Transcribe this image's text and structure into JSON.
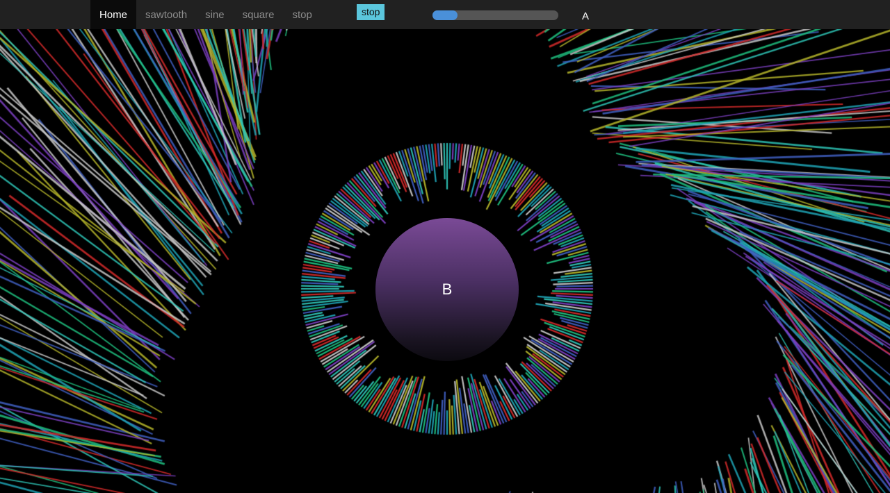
{
  "nav": {
    "items": [
      {
        "label": "Home",
        "active": true
      },
      {
        "label": "sawtooth",
        "active": false
      },
      {
        "label": "sine",
        "active": false
      },
      {
        "label": "square",
        "active": false
      },
      {
        "label": "stop",
        "active": false
      }
    ]
  },
  "controls": {
    "stop_label": "stop",
    "accent_color": "#5bc6dc",
    "slider_fraction": 0.2,
    "slider_color": "#4a90d9",
    "marker_label": "A"
  },
  "visualizer": {
    "center_label": "B",
    "line_colors": [
      "#c8c8c8",
      "#b5b52a",
      "#7b3fc1",
      "#2ec4b6",
      "#1fbf7f",
      "#d42a2a",
      "#3f5fc1",
      "#1fa3b5"
    ]
  }
}
